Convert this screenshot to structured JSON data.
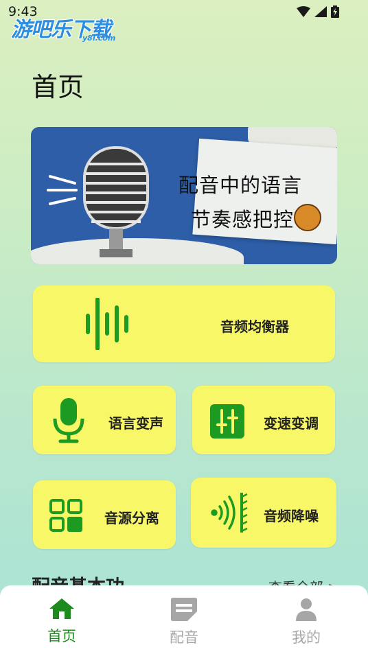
{
  "status_bar": {
    "time": "9:43",
    "wifi_icon": "wifi-icon",
    "signal_icon": "signal-icon",
    "battery_icon": "battery-icon"
  },
  "watermark": {
    "main": "游吧乐下载",
    "sub": "y8l.com"
  },
  "header": {
    "title": "首页"
  },
  "banner": {
    "line1": "配音中的语言",
    "line2": "节奏感把控"
  },
  "features": {
    "equalizer": {
      "label": "音频均衡器",
      "icon": "waveform-icon"
    },
    "voice_changer": {
      "label": "语言变声",
      "icon": "microphone-icon"
    },
    "speed_pitch": {
      "label": "变速变调",
      "icon": "sliders-icon"
    },
    "source_separation": {
      "label": "音源分离",
      "icon": "grid-icon"
    },
    "noise_reduction": {
      "label": "音频降噪",
      "icon": "sound-waves-icon"
    }
  },
  "section": {
    "title": "配音基本功",
    "see_all": "查看全部 >"
  },
  "bottom_nav": [
    {
      "label": "首页",
      "icon": "home-icon",
      "active": true
    },
    {
      "label": "配音",
      "icon": "document-icon",
      "active": false
    },
    {
      "label": "我的",
      "icon": "user-icon",
      "active": false
    }
  ],
  "colors": {
    "accent_green": "#1d8a1d",
    "card_yellow": "#f7f768",
    "inactive_gray": "#a6a6a6"
  }
}
